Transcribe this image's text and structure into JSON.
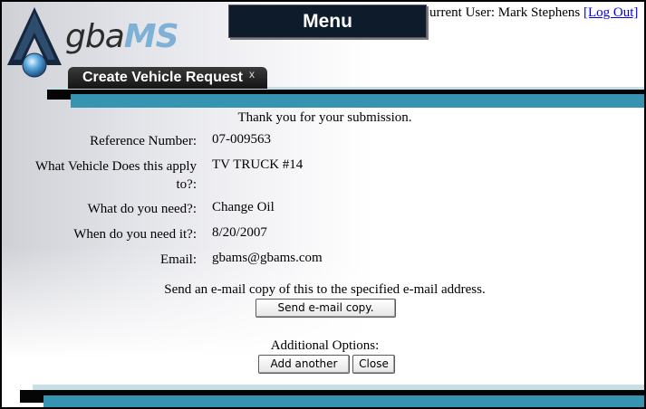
{
  "header": {
    "logo_text": "gba",
    "logo_text_ms": "MS",
    "menu_label": "Menu",
    "current_user_label": "Current User: Mark Stephens",
    "logout_label": "[Log Out]"
  },
  "tab": {
    "title": "Create Vehicle Request",
    "close_label": "x"
  },
  "confirmation": {
    "message": "Thank you for your submission.",
    "fields": [
      {
        "label": "Reference Number:",
        "value": "07-009563"
      },
      {
        "label": "What Vehicle Does this apply to?:",
        "value": "TV TRUCK #14"
      },
      {
        "label": "What do you need?:",
        "value": "Change Oil"
      },
      {
        "label": "When do you need it?:",
        "value": "8/20/2007"
      },
      {
        "label": "Email:",
        "value": "gbams@gbams.com"
      }
    ]
  },
  "email_section": {
    "text": "Send an e-mail copy of this to the specified e-mail address.",
    "button_label": "Send e-mail copy."
  },
  "options_section": {
    "text": "Additional Options:",
    "add_label": "Add another",
    "close_label": "Close"
  },
  "colors": {
    "accent_blue": "#3794b1",
    "light_blue": "#c9dfe8",
    "dark": "#050505"
  }
}
